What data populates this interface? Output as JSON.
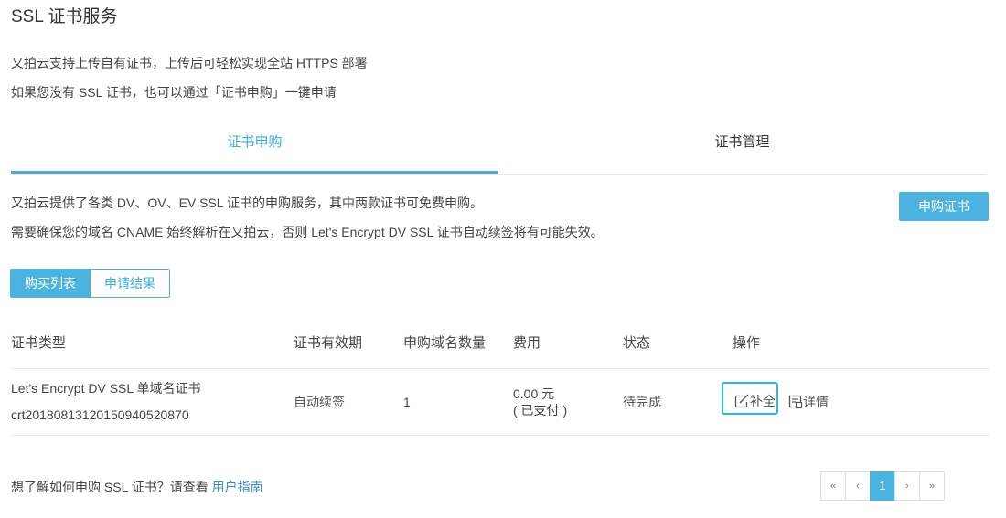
{
  "page": {
    "title": "SSL 证书服务"
  },
  "intro": {
    "line1": "又拍云支持上传自有证书，上传后可轻松实现全站 HTTPS 部署",
    "line2": "如果您没有 SSL 证书，也可以通过「证书申购」一键申请"
  },
  "tabs": [
    {
      "label": "证书申购",
      "active": true
    },
    {
      "label": "证书管理",
      "active": false
    }
  ],
  "description": {
    "line1": "又拍云提供了各类 DV、OV、EV SSL 证书的申购服务，其中两款证书可免费申购。",
    "line2": "需要确保您的域名 CNAME 始终解析在又拍云，否则 Let's Encrypt DV SSL 证书自动续签将有可能失效。"
  },
  "apply_button": "申购证书",
  "segments": [
    {
      "label": "购买列表",
      "active": true
    },
    {
      "label": "申请结果",
      "active": false
    }
  ],
  "table": {
    "headers": [
      "证书类型",
      "证书有效期",
      "申购域名数量",
      "费用",
      "状态",
      "操作"
    ],
    "rows": [
      {
        "type": "Let's Encrypt DV SSL 单域名证书",
        "order_id": "crt20180813120150940520870",
        "validity": "自动续签",
        "domain_count": "1",
        "fee": "0.00 元",
        "fee_status": "( 已支付 )",
        "status": "待完成",
        "actions": {
          "supplement": "补全",
          "detail": "详情"
        }
      }
    ]
  },
  "footer": {
    "text": "想了解如何申购 SSL 证书？请查看",
    "link": "用户指南"
  },
  "pagination": {
    "first": "«",
    "prev": "‹",
    "current": "1",
    "next": "›",
    "last": "»"
  },
  "colors": {
    "accent": "#4cb3e0",
    "focus_outline": "#25b7e6",
    "link": "#3a8fc8"
  },
  "icons": {
    "supplement": "edit-icon",
    "detail": "document-icon"
  }
}
